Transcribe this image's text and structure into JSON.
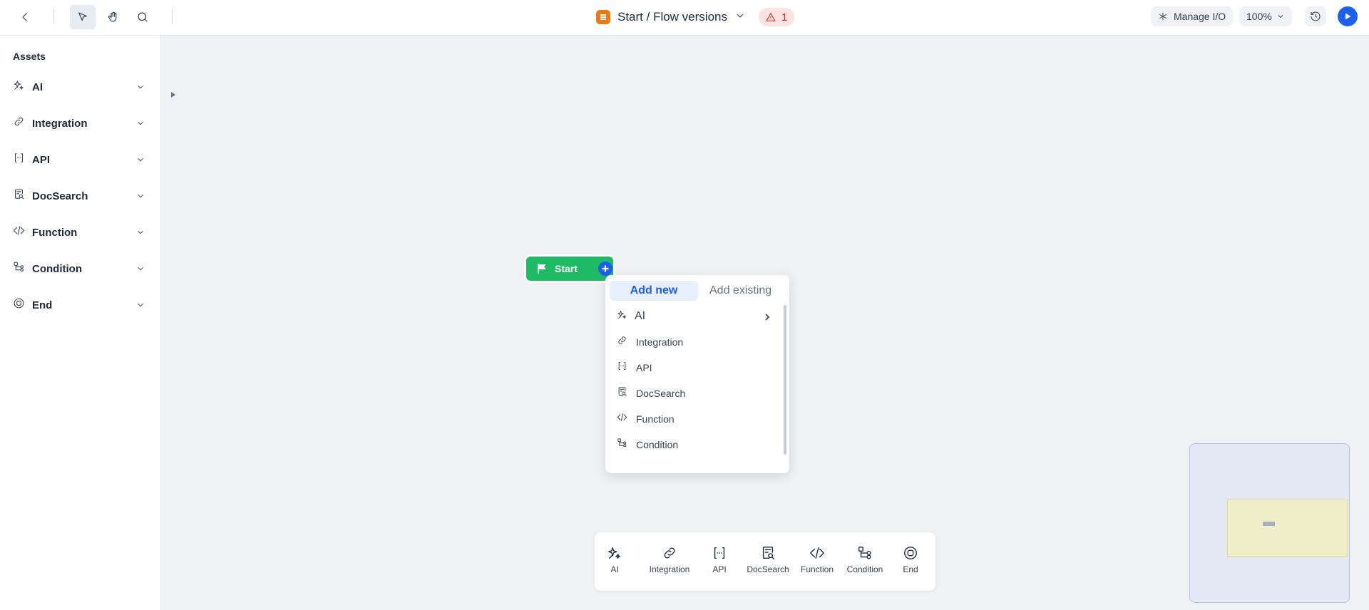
{
  "topbar": {
    "title": "Start / Flow versions",
    "warning_count": "1",
    "manage_io": "Manage I/O",
    "zoom": "100%"
  },
  "sidebar": {
    "heading": "Assets",
    "items": [
      {
        "label": "AI",
        "icon": "sparkles-icon"
      },
      {
        "label": "Integration",
        "icon": "link-icon"
      },
      {
        "label": "API",
        "icon": "braces-icon"
      },
      {
        "label": "DocSearch",
        "icon": "doc-search-icon"
      },
      {
        "label": "Function",
        "icon": "code-icon"
      },
      {
        "label": "Condition",
        "icon": "branch-icon"
      },
      {
        "label": "End",
        "icon": "stop-circle-icon"
      }
    ]
  },
  "canvas": {
    "start_node_label": "Start"
  },
  "popup": {
    "tabs": {
      "add_new": "Add new",
      "add_existing": "Add existing"
    },
    "items": [
      {
        "label": "AI",
        "icon": "sparkles-icon"
      },
      {
        "label": "Integration",
        "icon": "link-icon"
      },
      {
        "label": "API",
        "icon": "braces-icon"
      },
      {
        "label": "DocSearch",
        "icon": "doc-search-icon"
      },
      {
        "label": "Function",
        "icon": "code-icon"
      },
      {
        "label": "Condition",
        "icon": "branch-icon"
      }
    ]
  },
  "palette": {
    "items": [
      {
        "label": "AI"
      },
      {
        "label": "Integration"
      },
      {
        "label": "API"
      },
      {
        "label": "DocSearch"
      },
      {
        "label": "Function"
      },
      {
        "label": "Condition"
      },
      {
        "label": "End"
      }
    ]
  },
  "colors": {
    "accent": "#1d5ff0",
    "start_node": "#1fba66",
    "warning": "#d92d20",
    "canvas_bg": "#eff1f5"
  }
}
